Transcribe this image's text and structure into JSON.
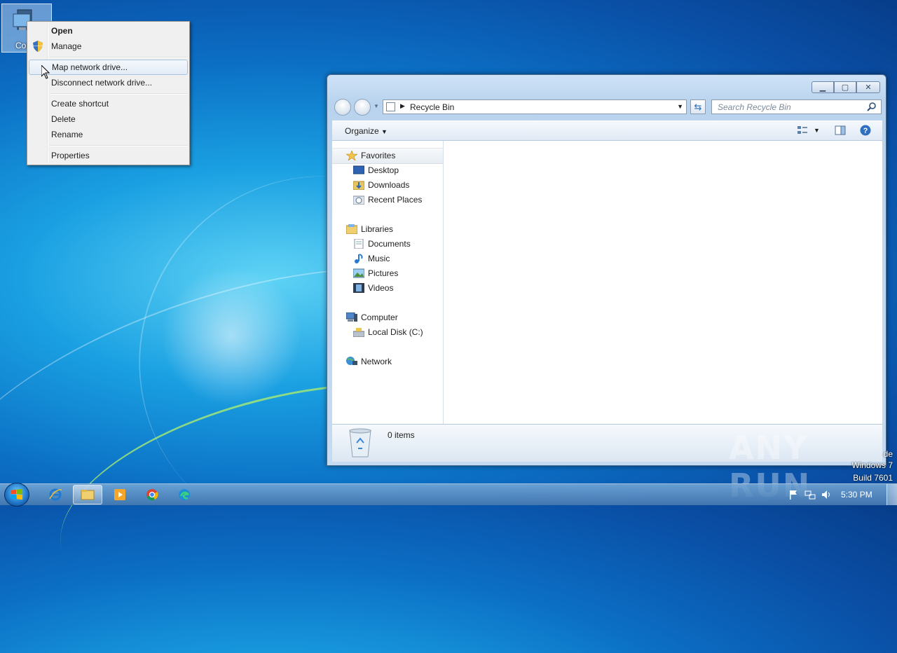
{
  "desktop": {
    "icon_label": "Comp"
  },
  "context_menu": {
    "items": [
      {
        "label": "Open"
      },
      {
        "label": "Manage"
      },
      {
        "label": "Map network drive..."
      },
      {
        "label": "Disconnect network drive..."
      },
      {
        "label": "Create shortcut"
      },
      {
        "label": "Delete"
      },
      {
        "label": "Rename"
      },
      {
        "label": "Properties"
      }
    ]
  },
  "explorer": {
    "address": "Recycle Bin",
    "search_placeholder": "Search Recycle Bin",
    "organize_label": "Organize",
    "nav": {
      "favorites": {
        "label": "Favorites",
        "items": [
          "Desktop",
          "Downloads",
          "Recent Places"
        ]
      },
      "libraries": {
        "label": "Libraries",
        "items": [
          "Documents",
          "Music",
          "Pictures",
          "Videos"
        ]
      },
      "computer": {
        "label": "Computer",
        "items": [
          "Local Disk (C:)"
        ]
      },
      "network": {
        "label": "Network"
      }
    },
    "status_count": "0 items"
  },
  "overlay": {
    "watermark": "ANY RUN",
    "os_line1": "de",
    "os_line2": "Windows 7",
    "os_line3": "Build 7601"
  },
  "taskbar": {
    "clock": "5:30 PM"
  },
  "colors": {
    "accent": "#1aa0e2",
    "selection_border": "#a8c3e0"
  }
}
